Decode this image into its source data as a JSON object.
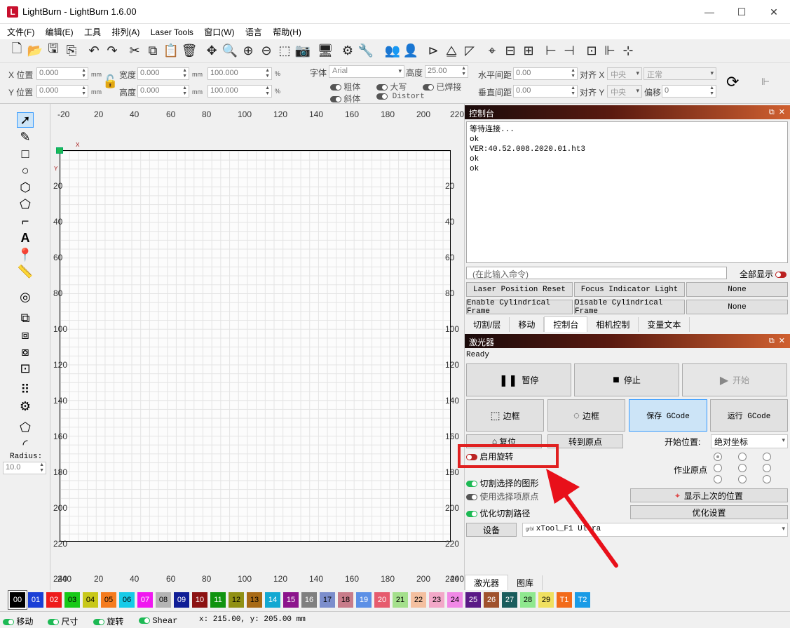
{
  "window": {
    "title": "LightBurn - LightBurn 1.6.00",
    "minimize": "—",
    "maximize": "☐",
    "close": "✕"
  },
  "menu": [
    "文件(F)",
    "编辑(E)",
    "工具",
    "排列(A)",
    "Laser Tools",
    "窗口(W)",
    "语言",
    "帮助(H)"
  ],
  "props": {
    "x_pos_label": "X 位置",
    "x_pos": "0.000",
    "y_pos_label": "Y 位置",
    "y_pos": "0.000",
    "width_label": "宽度",
    "width": "0.000",
    "height_label": "高度",
    "height": "0.000",
    "scale_w": "100.000",
    "scale_h": "100.000",
    "unit": "mm",
    "pct": "%",
    "font_label": "字体",
    "font": "Arial",
    "font_height_label": "高度",
    "font_height": "25.00",
    "bold": "粗体",
    "upper": "大写",
    "welded": "已焊接",
    "italic": "斜体",
    "distort": "Distort",
    "hspace_label": "水平间距",
    "hspace": "0.00",
    "vspace_label": "垂直间距",
    "vspace": "0.00",
    "align_x_label": "对齐 X",
    "align_x": "中央",
    "align_mode": "正常",
    "align_y_label": "对齐 Y",
    "align_y": "中央",
    "offset_label": "偏移",
    "offset": "0"
  },
  "tools": {
    "radius_label": "Radius:",
    "radius": "10.0"
  },
  "ruler_top": [
    "-20",
    "20",
    "40",
    "60",
    "80",
    "100",
    "120",
    "140",
    "160",
    "180",
    "200",
    "220"
  ],
  "ruler_bottom": [
    "240",
    "20",
    "40",
    "60",
    "80",
    "100",
    "120",
    "140",
    "160",
    "180",
    "200",
    "240"
  ],
  "ruler_left": [
    "20",
    "40",
    "60",
    "80",
    "100",
    "120",
    "140",
    "160",
    "180",
    "200",
    "220",
    "240"
  ],
  "axis": {
    "x": "X",
    "y": "Y"
  },
  "console": {
    "title": "控制台",
    "lines": [
      "等待连接...",
      "ok",
      "VER:40.52.008.2020.01.ht3",
      "ok",
      "ok"
    ],
    "input_placeholder": "(在此输入命令)",
    "show_all": "全部显示",
    "macros": [
      "Laser Position Reset",
      "Focus Indicator Light",
      "None",
      "Enable Cylindrical Frame",
      "Disable Cylindrical Frame",
      "None"
    ],
    "tabs": [
      "切割/层",
      "移动",
      "控制台",
      "相机控制",
      "变量文本"
    ]
  },
  "laser": {
    "title": "激光器",
    "status": "Ready",
    "pause": "暂停",
    "stop": "停止",
    "start": "开始",
    "frame1": "边框",
    "frame2": "边框",
    "save_gcode": "保存 GCode",
    "run_gcode": "运行 GCode",
    "home": "复位",
    "goto_origin": "转到原点",
    "start_from_label": "开始位置:",
    "start_from": "绝对坐标",
    "enable_rotary": "启用旋转",
    "job_origin": "作业原点",
    "cut_selected": "切割选择的图形",
    "use_sel_origin": "使用选择项原点",
    "optimize_path": "优化切割路径",
    "show_last": "显示上次的位置",
    "optimize_settings": "优化设置",
    "device_btn": "设备",
    "device_name": "xTool_F1 Ultra",
    "device_prefix": "grbl",
    "bottom_tabs": [
      "激光器",
      "图库"
    ]
  },
  "palette": [
    {
      "n": "00",
      "c": "#000000",
      "t": "#fff"
    },
    {
      "n": "01",
      "c": "#1a3fd6",
      "t": "#fff"
    },
    {
      "n": "02",
      "c": "#ee1c1c",
      "t": "#fff"
    },
    {
      "n": "03",
      "c": "#17c917",
      "t": "#000"
    },
    {
      "n": "04",
      "c": "#c8c81a",
      "t": "#000"
    },
    {
      "n": "05",
      "c": "#f57c1e",
      "t": "#000"
    },
    {
      "n": "06",
      "c": "#16cbe8",
      "t": "#000"
    },
    {
      "n": "07",
      "c": "#f017f0",
      "t": "#fff"
    },
    {
      "n": "08",
      "c": "#b4b4b4",
      "t": "#000"
    },
    {
      "n": "09",
      "c": "#101e96",
      "t": "#fff"
    },
    {
      "n": "10",
      "c": "#8c1212",
      "t": "#fff"
    },
    {
      "n": "11",
      "c": "#109410",
      "t": "#fff"
    },
    {
      "n": "12",
      "c": "#909014",
      "t": "#000"
    },
    {
      "n": "13",
      "c": "#a86a16",
      "t": "#000"
    },
    {
      "n": "14",
      "c": "#12a8d2",
      "t": "#fff"
    },
    {
      "n": "15",
      "c": "#8c148c",
      "t": "#fff"
    },
    {
      "n": "16",
      "c": "#808080",
      "t": "#fff"
    },
    {
      "n": "17",
      "c": "#7c8ecc",
      "t": "#000"
    },
    {
      "n": "18",
      "c": "#c87c8a",
      "t": "#000"
    },
    {
      "n": "19",
      "c": "#5c90e6",
      "t": "#fff"
    },
    {
      "n": "20",
      "c": "#e65c6e",
      "t": "#fff"
    },
    {
      "n": "21",
      "c": "#a4e08c",
      "t": "#000"
    },
    {
      "n": "22",
      "c": "#f4c0a0",
      "t": "#000"
    },
    {
      "n": "23",
      "c": "#f2a8c8",
      "t": "#000"
    },
    {
      "n": "24",
      "c": "#f088e6",
      "t": "#000"
    },
    {
      "n": "25",
      "c": "#5a1a86",
      "t": "#fff"
    },
    {
      "n": "26",
      "c": "#a0522d",
      "t": "#fff"
    },
    {
      "n": "27",
      "c": "#1a5c5c",
      "t": "#fff"
    },
    {
      "n": "28",
      "c": "#8fe88f",
      "t": "#000"
    },
    {
      "n": "29",
      "c": "#f0e060",
      "t": "#000"
    },
    {
      "n": "T1",
      "c": "#f26b1a",
      "t": "#fff"
    },
    {
      "n": "T2",
      "c": "#1a9be6",
      "t": "#fff"
    }
  ],
  "status": {
    "move": "移动",
    "size": "尺寸",
    "rotate": "旋转",
    "shear": "Shear",
    "coords": "x: 215.00, y: 205.00 mm"
  },
  "colors": {
    "highlight_box": "#e02020",
    "arrow": "#e8101a",
    "toggle_on": "#1db954"
  }
}
